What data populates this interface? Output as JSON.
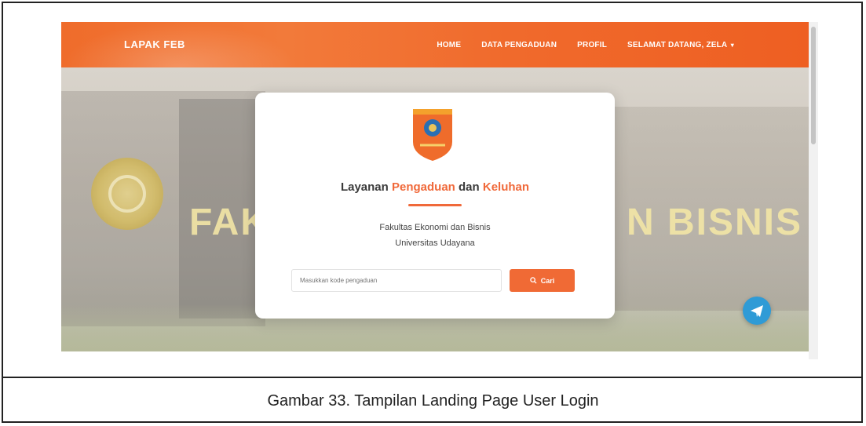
{
  "navbar": {
    "brand": "LAPAK FEB",
    "items": [
      "HOME",
      "DATA PENGADUAN",
      "PROFIL"
    ],
    "user_menu": "SELAMAT DATANG, ZELA"
  },
  "hero": {
    "wall_text_left": "FAK",
    "wall_text_right": "N BISNIS"
  },
  "card": {
    "title_part1": "Layanan ",
    "title_part2": "Pengaduan",
    "title_part3": " dan ",
    "title_part4": "Keluhan",
    "subtitle_line1": "Fakultas Ekonomi dan Bisnis",
    "subtitle_line2": "Universitas Udayana",
    "search_placeholder": "Masukkan kode pengaduan",
    "search_button": "Cari"
  },
  "caption": "Gambar 33. Tampilan Landing Page User Login",
  "colors": {
    "accent": "#f0693a",
    "navbar": "#ef6c2b",
    "telegram": "#2f9bd6"
  },
  "icons": {
    "search": "search-icon",
    "telegram": "telegram-icon",
    "logo": "university-shield-logo"
  }
}
